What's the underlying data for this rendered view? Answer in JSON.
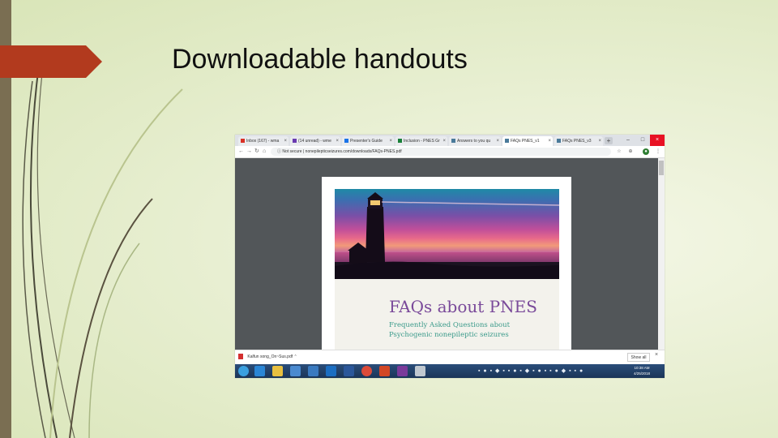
{
  "slide": {
    "title": "Downloadable handouts"
  },
  "browser": {
    "tabs": [
      {
        "label": "Inbox (167) - wma",
        "favicon": "gmail-icon",
        "color": "#d93025",
        "active": false
      },
      {
        "label": "(14 unread) - wme",
        "favicon": "mail-icon",
        "color": "#6a3ab0",
        "active": false
      },
      {
        "label": "Presenter's Guide",
        "favicon": "docs-icon",
        "color": "#1a73e8",
        "active": false
      },
      {
        "label": "Inclusion - PNES Gr",
        "favicon": "sheets-icon",
        "color": "#188038",
        "active": false
      },
      {
        "label": "Answers to you qu",
        "favicon": "p-icon",
        "color": "#4a7a9a",
        "active": false
      },
      {
        "label": "FAQs PNES_v1",
        "favicon": "p-icon",
        "color": "#4a7a9a",
        "active": true
      },
      {
        "label": "FAQs PNES_v3",
        "favicon": "p-icon",
        "color": "#4a7a9a",
        "active": false
      }
    ],
    "new_tab": "+",
    "url_prefix": "Not secure",
    "url": "nonepilepticseizures.com/downloads/FAQs-PNES.pdf"
  },
  "pdf": {
    "title": "FAQs about PNES",
    "subtitle_line1": "Frequently Asked Questions about",
    "subtitle_line2": "Psychogenic nonepileptic seizures"
  },
  "download_bar": {
    "file": "Kalfun song_On~Sus.pdf",
    "show_all": "Show all"
  },
  "taskbar": {
    "time": "10:38 AM",
    "date": "4/25/2018",
    "apps": [
      {
        "name": "start-icon",
        "color": "#3aa0e0"
      },
      {
        "name": "ie-icon",
        "color": "#2a86d6"
      },
      {
        "name": "explorer-icon",
        "color": "#e8c040"
      },
      {
        "name": "media-icon",
        "color": "#4a8ad0"
      },
      {
        "name": "media2-icon",
        "color": "#3a7ac0"
      },
      {
        "name": "outlook-icon",
        "color": "#1b6ec2"
      },
      {
        "name": "word-icon",
        "color": "#2b579a"
      },
      {
        "name": "chrome-icon",
        "color": "#dd4b39"
      },
      {
        "name": "powerpoint-icon",
        "color": "#d24726"
      },
      {
        "name": "onenote-icon",
        "color": "#7a3a9a"
      },
      {
        "name": "misc-icon",
        "color": "#c0c8d0"
      }
    ]
  }
}
